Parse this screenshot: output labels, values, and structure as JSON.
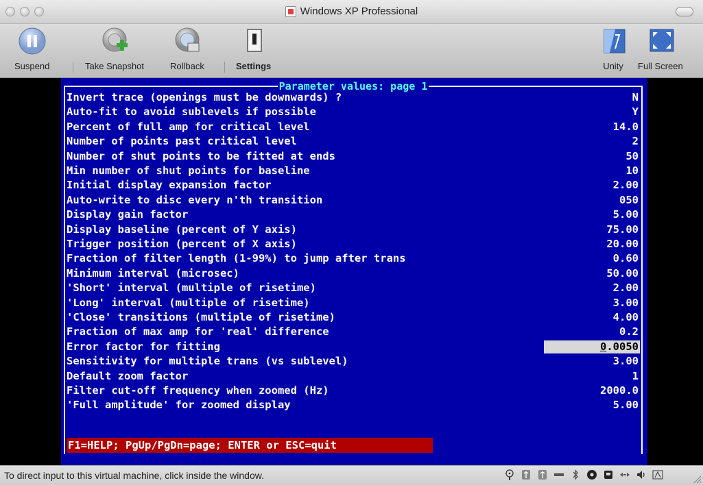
{
  "window": {
    "title": "Windows XP Professional"
  },
  "toolbar": {
    "suspend": "Suspend",
    "snapshot": "Take Snapshot",
    "rollback": "Rollback",
    "settings": "Settings",
    "unity": "Unity",
    "fullscreen": "Full Screen"
  },
  "dos": {
    "title": "Parameter values: page 1",
    "rows": [
      {
        "label": "Invert trace (openings must be downwards) ?",
        "value": "N"
      },
      {
        "label": "Auto-fit to avoid sublevels if possible",
        "value": "Y"
      },
      {
        "label": "Percent of full amp for critical level",
        "value": "14.0"
      },
      {
        "label": "Number of points past critical level",
        "value": "2"
      },
      {
        "label": "Number of shut points to be fitted at ends",
        "value": "50"
      },
      {
        "label": "Min number of shut points for baseline",
        "value": "10"
      },
      {
        "label": "Initial display expansion factor",
        "value": "2.00"
      },
      {
        "label": "Auto-write to disc every n'th transition",
        "value": "050"
      },
      {
        "label": "Display gain factor",
        "value": "5.00"
      },
      {
        "label": "Display baseline (percent of Y axis)",
        "value": "75.00"
      },
      {
        "label": "Trigger position (percent of X axis)",
        "value": "20.00"
      },
      {
        "label": "Fraction of filter length (1-99%) to jump after trans",
        "value": "0.60"
      },
      {
        "label": "Minimum interval (microsec)",
        "value": "50.00"
      },
      {
        "label": "'Short' interval (multiple of risetime)",
        "value": "2.00"
      },
      {
        "label": "'Long' interval (multiple of risetime)",
        "value": "3.00"
      },
      {
        "label": "'Close' transitions (multiple of risetime)",
        "value": "4.00"
      },
      {
        "label": "Fraction of max amp for 'real' difference",
        "value": "0.2"
      },
      {
        "label": "Error factor for fitting",
        "value_cursor": "0",
        "value_rest": ".0050"
      },
      {
        "label": "Sensitivity for multiple trans (vs sublevel)",
        "value": "3.00"
      },
      {
        "label": "Default zoom factor",
        "value": "1"
      },
      {
        "label": "Filter cut-off frequency when zoomed (Hz)",
        "value": "2000.0"
      },
      {
        "label": "'Full amplitude' for zoomed display",
        "value": "5.00"
      }
    ],
    "help": "F1=HELP; PgUp/PgDn=page; ENTER or ESC=quit"
  },
  "status": {
    "text": "To direct input to this virtual machine, click inside the window."
  },
  "colors": {
    "dos_bg": "#0000a8",
    "dos_title": "#54ffff",
    "help_bg": "#b00000"
  }
}
